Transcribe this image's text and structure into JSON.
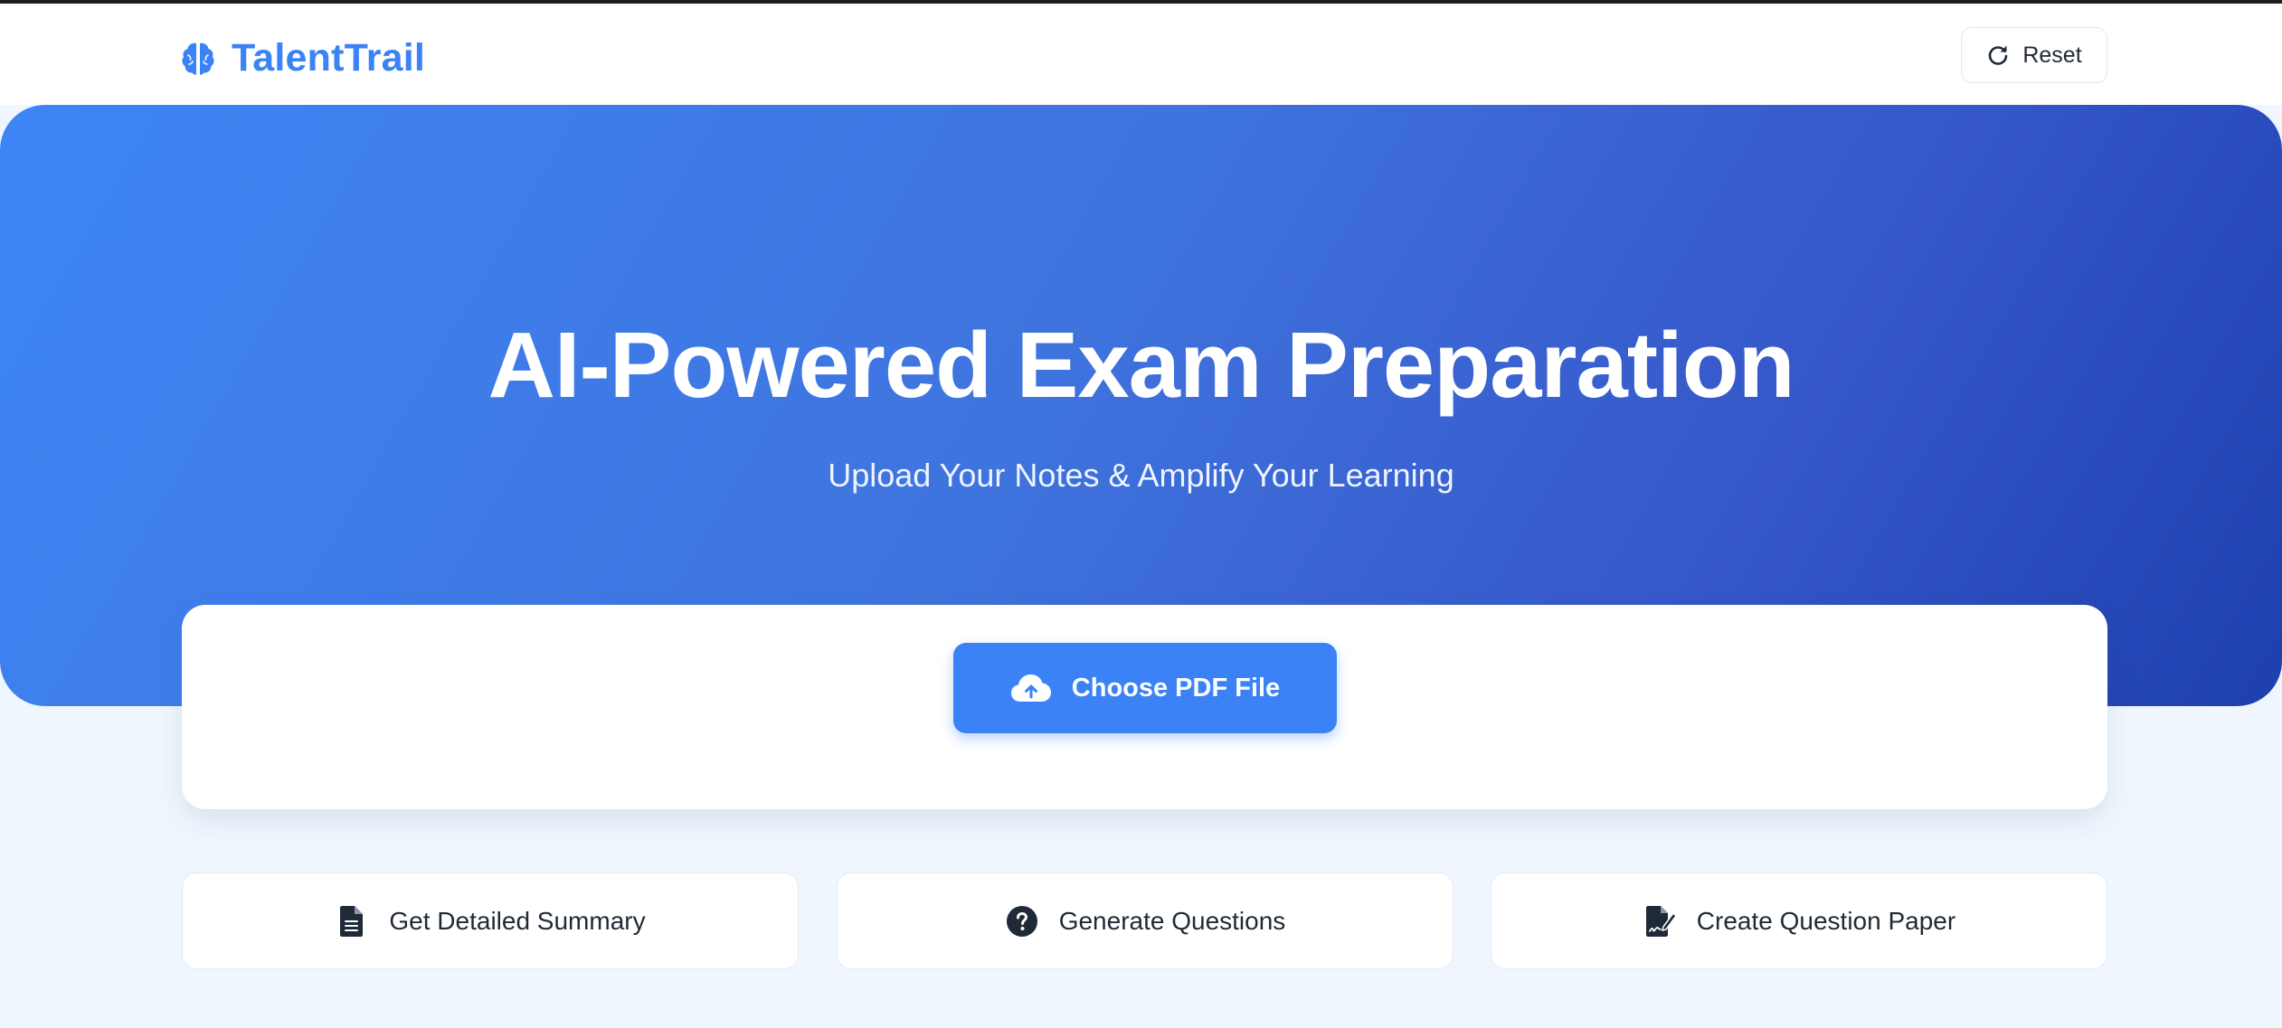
{
  "header": {
    "brand_name": "TalentTrail",
    "brand_icon": "brain-icon",
    "reset_label": "Reset",
    "reset_icon": "rotate-right-icon"
  },
  "hero": {
    "title": "AI-Powered Exam Preparation",
    "subtitle": "Upload Your Notes & Amplify Your Learning"
  },
  "upload": {
    "button_label": "Choose PDF File",
    "button_icon": "cloud-upload-icon"
  },
  "actions": [
    {
      "label": "Get Detailed Summary",
      "icon": "file-lines-icon"
    },
    {
      "label": "Generate Questions",
      "icon": "question-circle-icon"
    },
    {
      "label": "Create Question Paper",
      "icon": "file-signature-icon"
    }
  ],
  "colors": {
    "brand": "#3b82f6",
    "hero_gradient_start": "#3d85f5",
    "hero_gradient_end": "#1e3fae",
    "page_background": "#eff6fd",
    "text_dark": "#1f2937"
  }
}
